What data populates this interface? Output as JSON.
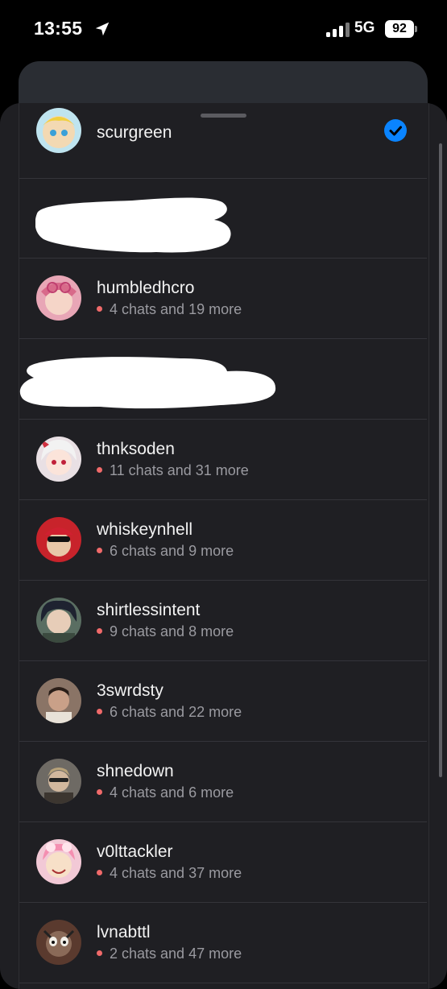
{
  "status_bar": {
    "time": "13:55",
    "network": "5G",
    "battery": "92"
  },
  "accounts": [
    {
      "username": "scurgreen",
      "selected": true
    },
    {
      "username": "",
      "redacted": true
    },
    {
      "username": "humbledhcro",
      "status": "4 chats and 19 more"
    },
    {
      "username": "",
      "redacted": true
    },
    {
      "username": "thnksoden",
      "status": "11 chats and 31 more"
    },
    {
      "username": "whiskeynhell",
      "status": "6 chats and 9 more"
    },
    {
      "username": "shirtlessintent",
      "status": "9 chats and 8 more"
    },
    {
      "username": "3swrdsty",
      "status": "6 chats and 22 more"
    },
    {
      "username": "shnedown",
      "status": "4 chats and 6 more"
    },
    {
      "username": "v0lttackler",
      "status": "4 chats and 37 more"
    },
    {
      "username": "lvnabttl",
      "status": "2 chats and 47 more"
    }
  ],
  "colors": {
    "sheet_bg": "#1f1f23",
    "unread_dot": "#f06a6a",
    "selected_check": "#0a84ff"
  }
}
